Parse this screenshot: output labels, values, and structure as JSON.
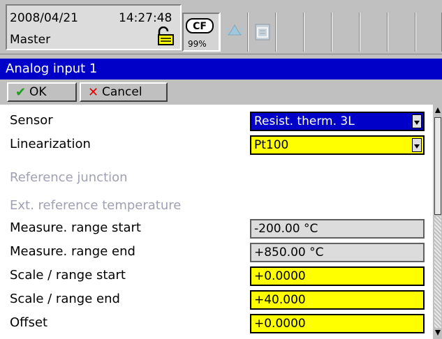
{
  "status": {
    "date": "2008/04/21",
    "time": "14:27:48",
    "user": "Master",
    "cf_label": "CF",
    "cf_percent": "99%",
    "icons": [
      "lock-icon",
      "bell-icon",
      "calendar-icon"
    ]
  },
  "window": {
    "title": "Analog input 1"
  },
  "toolbar": {
    "ok_label": "OK",
    "cancel_label": "Cancel"
  },
  "form": {
    "rows": [
      {
        "label": "Sensor",
        "value": "Resist. therm. 3L",
        "type": "select",
        "disabled": false
      },
      {
        "label": "Linearization",
        "value": "Pt100",
        "type": "select",
        "disabled": false
      },
      {
        "label": "Reference junction",
        "value": "",
        "type": "none",
        "disabled": true
      },
      {
        "label": "Ext. reference temperature",
        "value": "",
        "type": "none",
        "disabled": true
      },
      {
        "label": "Measure. range start",
        "value": "-200.00 °C",
        "type": "readonly",
        "disabled": false
      },
      {
        "label": "Measure. range end",
        "value": "+850.00 °C",
        "type": "readonly",
        "disabled": false
      },
      {
        "label": "Scale / range start",
        "value": "+0.0000",
        "type": "edit",
        "disabled": false
      },
      {
        "label": "Scale / range end",
        "value": "+40.000",
        "type": "edit",
        "disabled": false
      },
      {
        "label": "Offset",
        "value": "+0.0000",
        "type": "edit",
        "disabled": false
      }
    ]
  },
  "colors": {
    "title_bg": "#0000c8",
    "edit_bg": "#ffff00",
    "disabled_text": "#a0a0b4"
  }
}
